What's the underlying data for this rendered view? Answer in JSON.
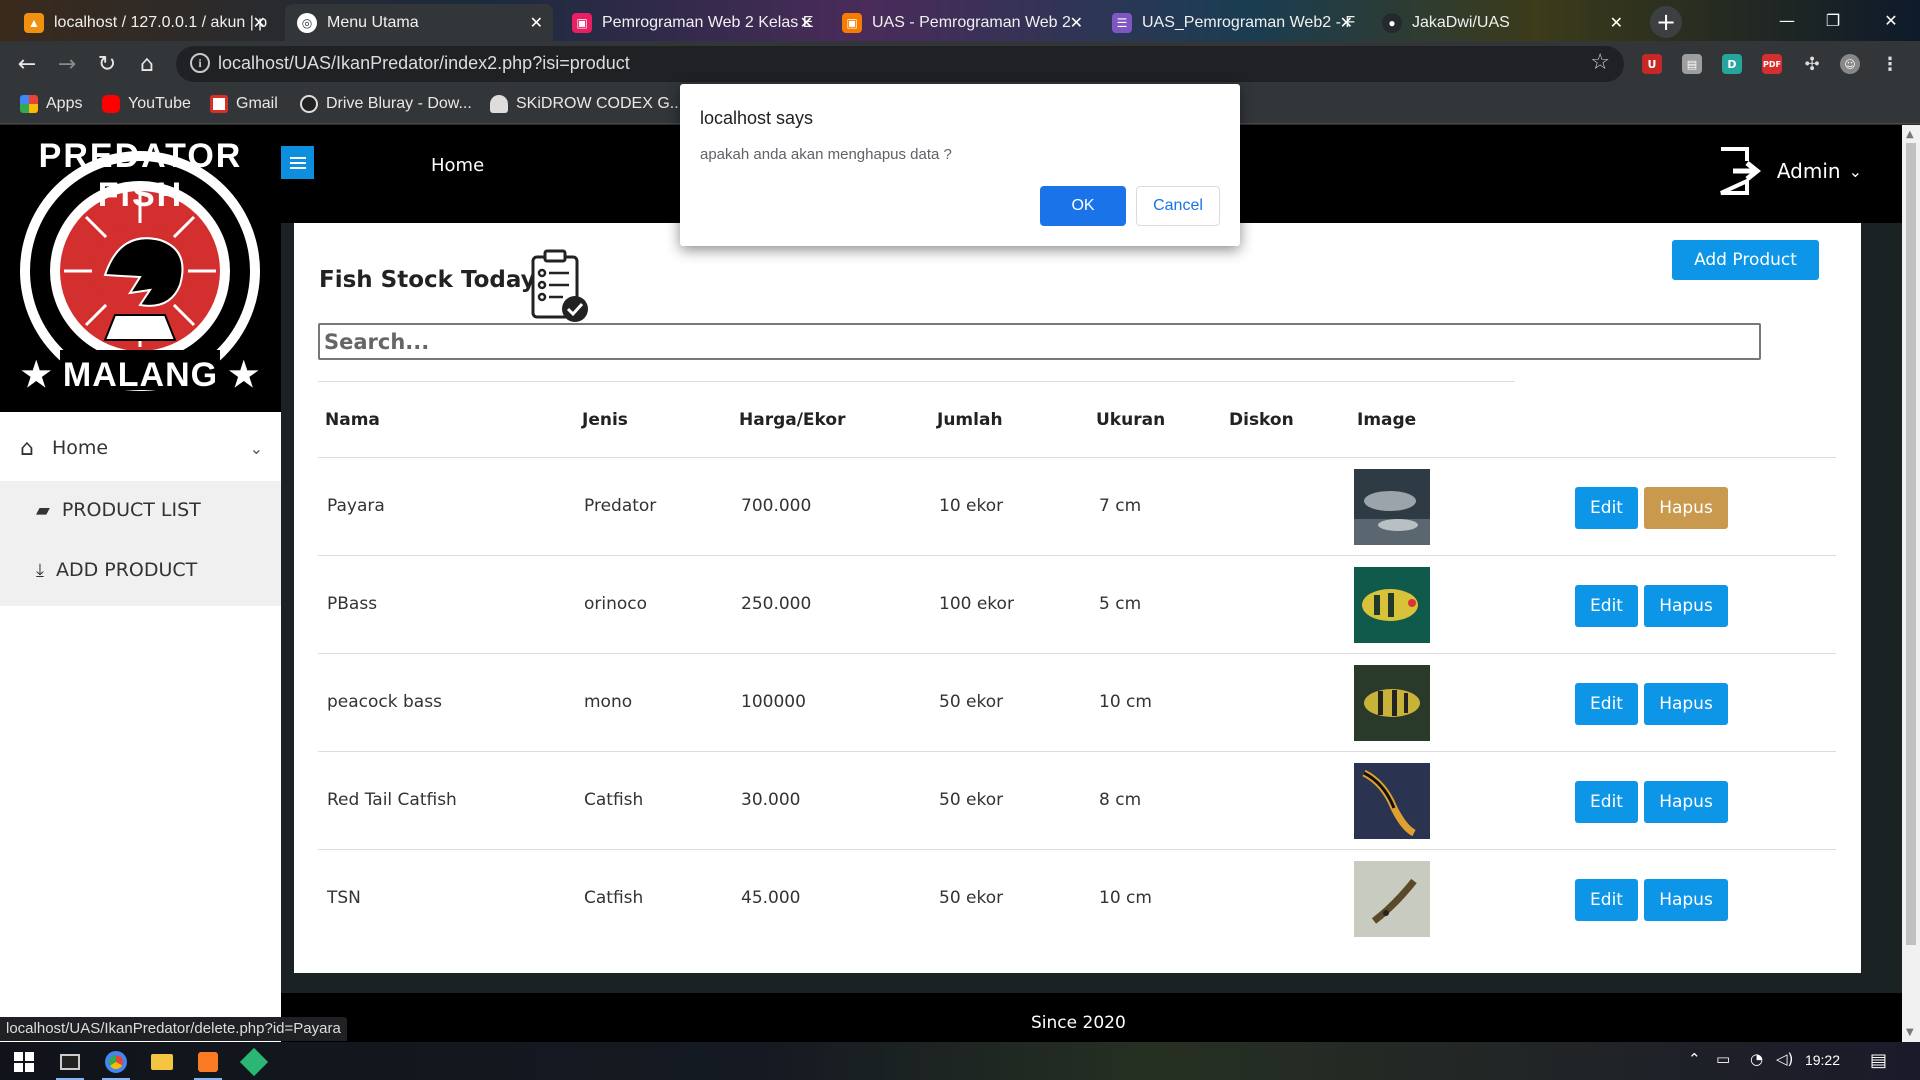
{
  "browser": {
    "tabs": [
      {
        "title": "localhost / 127.0.0.1 / akun | p",
        "color": "#f29111"
      },
      {
        "title": "Menu Utama",
        "color": "#ffffff"
      },
      {
        "title": "Pemrograman Web 2 Kelas E",
        "color": "#e91e63"
      },
      {
        "title": "UAS - Pemrograman Web 2",
        "color": "#f57c00"
      },
      {
        "title": "UAS_Pemrograman Web2 - F",
        "color": "#7e57c2"
      },
      {
        "title": "JakaDwi/UAS",
        "color": "#24292e"
      }
    ],
    "url": "localhost/UAS/IkanPredator/index2.php?isi=product",
    "bookmarks": [
      "Apps",
      "YouTube",
      "Gmail",
      "Drive Bluray - Dow...",
      "SKiDROW CODEX G..."
    ]
  },
  "nav": {
    "home": "Home",
    "admin": "Admin"
  },
  "sidebar": {
    "brand_top": "PREDATOR FISH",
    "brand_bottom": "MALANG",
    "home": "Home",
    "items": [
      {
        "label": "PRODUCT LIST",
        "icon": "briefcase-icon"
      },
      {
        "label": "ADD PRODUCT",
        "icon": "download-icon"
      }
    ]
  },
  "main": {
    "title": "Fish Stock Today",
    "add_button": "Add Product",
    "search_placeholder": "Search...",
    "columns": [
      "Nama",
      "Jenis",
      "Harga/Ekor",
      "Jumlah",
      "Ukuran",
      "Diskon",
      "Image"
    ],
    "rows": [
      {
        "nama": "Payara",
        "jenis": "Predator",
        "harga": "700.000",
        "jumlah": "10 ekor",
        "ukuran": "7 cm",
        "diskon": ""
      },
      {
        "nama": "PBass",
        "jenis": "orinoco",
        "harga": "250.000",
        "jumlah": "100 ekor",
        "ukuran": "5 cm",
        "diskon": ""
      },
      {
        "nama": "peacock bass",
        "jenis": "mono",
        "harga": "100000",
        "jumlah": "50 ekor",
        "ukuran": "10 cm",
        "diskon": ""
      },
      {
        "nama": "Red Tail Catfish",
        "jenis": "Catfish",
        "harga": "30.000",
        "jumlah": "50 ekor",
        "ukuran": "8 cm",
        "diskon": ""
      },
      {
        "nama": "TSN",
        "jenis": "Catfish",
        "harga": "45.000",
        "jumlah": "50 ekor",
        "ukuran": "10 cm",
        "diskon": ""
      }
    ],
    "edit_label": "Edit",
    "delete_label": "Hapus"
  },
  "footer": {
    "text": "Since 2020"
  },
  "statusbar": "localhost/UAS/IkanPredator/delete.php?id=Payara",
  "dialog": {
    "title": "localhost says",
    "message": "apakah anda akan menghapus data ?",
    "ok": "OK",
    "cancel": "Cancel"
  },
  "taskbar": {
    "time": "19:22"
  },
  "colors": {
    "accent": "#0d95e8",
    "hover_delete": "#c99a4e",
    "dialog_ok": "#1a73e8"
  }
}
